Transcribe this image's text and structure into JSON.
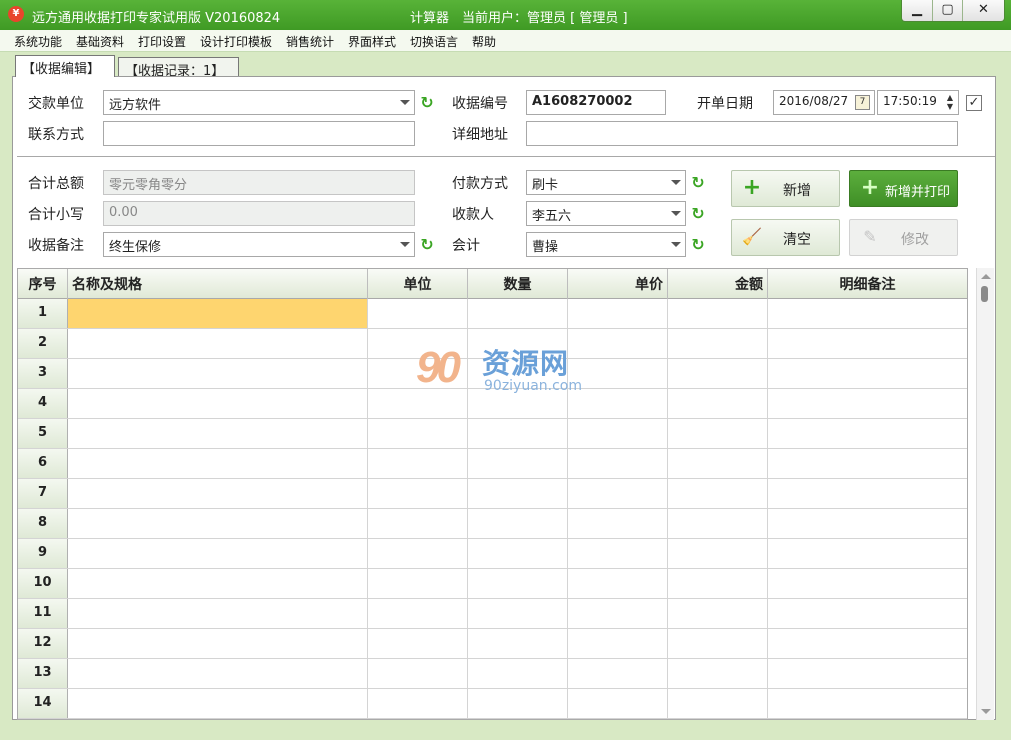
{
  "titlebar": {
    "title": "远方通用收据打印专家试用版 V20160824",
    "calculator": "计算器",
    "current_user": "当前用户：管理员 [ 管理员 ]",
    "minimize": "▁",
    "maximize": "▢",
    "close": "✕",
    "app_icon": "¥"
  },
  "menu": [
    "系统功能",
    "基础资料",
    "打印设置",
    "设计打印模板",
    "销售统计",
    "界面样式",
    "切换语言",
    "帮助"
  ],
  "tabs": {
    "edit": "【收据编辑】",
    "records": "【收据记录：1】"
  },
  "form": {
    "payer_label": "交款单位",
    "payer_value": "远方软件",
    "receipt_no_label": "收据编号",
    "receipt_no_value": "A1608270002",
    "date_label": "开单日期",
    "date_value": "2016/08/27",
    "time_value": "17:50:19",
    "date_checked": "✓",
    "calendar_icon": "7",
    "contact_label": "联系方式",
    "contact_value": "",
    "address_label": "详细地址",
    "address_value": "",
    "total_cn_label": "合计总额",
    "total_cn_value": "零元零角零分",
    "total_num_label": "合计小写",
    "total_num_value": "0.00",
    "remark_label": "收据备注",
    "remark_value": "终生保修",
    "pay_method_label": "付款方式",
    "pay_method_value": "刷卡",
    "payee_label": "收款人",
    "payee_value": "李五六",
    "accountant_label": "会计",
    "accountant_value": "曹操"
  },
  "buttons": {
    "add": "新增",
    "add_print": "新增并打印",
    "clear": "清空",
    "modify": "修改"
  },
  "grid": {
    "headers": [
      "序号",
      "名称及规格",
      "单位",
      "数量",
      "单价",
      "金额",
      "明细备注"
    ],
    "rows": [
      "1",
      "2",
      "3",
      "4",
      "5",
      "6",
      "7",
      "8",
      "9",
      "10",
      "11",
      "12",
      "13",
      "14"
    ]
  },
  "watermark": {
    "logo": "90",
    "cn": "资源网",
    "url": "90ziyuan.com"
  },
  "colors": {
    "accent_green": "#4aa52c",
    "selected_cell": "#fed56f"
  },
  "icons": [
    "app-icon",
    "refresh-icon",
    "calendar-icon",
    "plus-icon",
    "broom-icon",
    "pencil-icon",
    "checkbox-icon"
  ]
}
